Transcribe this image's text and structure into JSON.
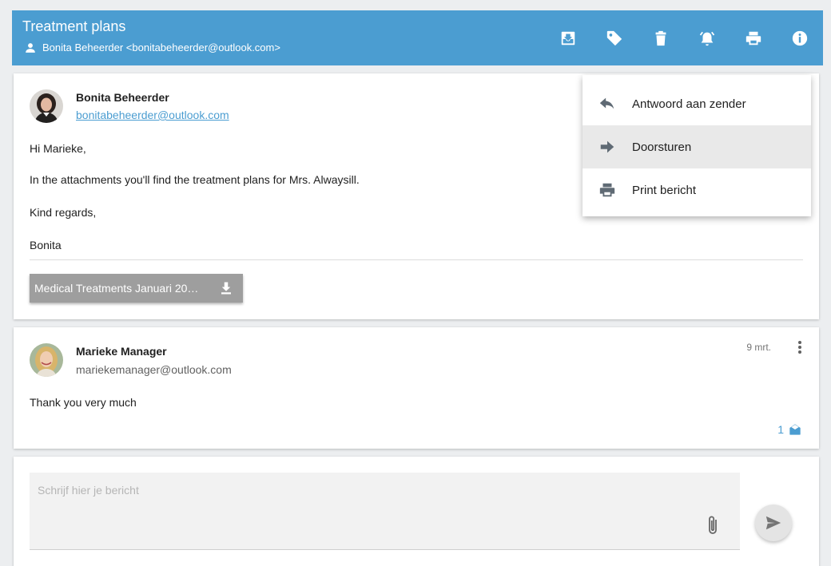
{
  "header": {
    "title": "Treatment plans",
    "subtitle": "Bonita Beheerder <bonitabeheerder@outlook.com>",
    "color": "#4b9dd1",
    "actions": [
      {
        "name": "archive-icon"
      },
      {
        "name": "tag-icon"
      },
      {
        "name": "trash-icon"
      },
      {
        "name": "alarm-icon"
      },
      {
        "name": "print-icon"
      },
      {
        "name": "info-icon"
      }
    ]
  },
  "message1": {
    "sender_name": "Bonita Beheerder",
    "sender_email": "bonitabeheerder@outlook.com",
    "greeting": "Hi Marieke,",
    "body": "In the attachments you'll find the treatment plans for Mrs. Alwaysill.",
    "closing": "Kind regards,",
    "signature": "Bonita",
    "attachment_label": "Medical Treatments Januari 20…"
  },
  "context_menu": {
    "items": [
      {
        "label": "Antwoord aan zender",
        "icon": "reply-icon"
      },
      {
        "label": "Doorsturen",
        "icon": "forward-icon",
        "active": true
      },
      {
        "label": "Print bericht",
        "icon": "print-icon"
      }
    ]
  },
  "message2": {
    "sender_name": "Marieke Manager",
    "sender_email": "mariekemanager@outlook.com",
    "date": "9 mrt.",
    "body": "Thank you very much",
    "read_count": "1"
  },
  "compose": {
    "placeholder": "Schrijf hier je bericht"
  }
}
